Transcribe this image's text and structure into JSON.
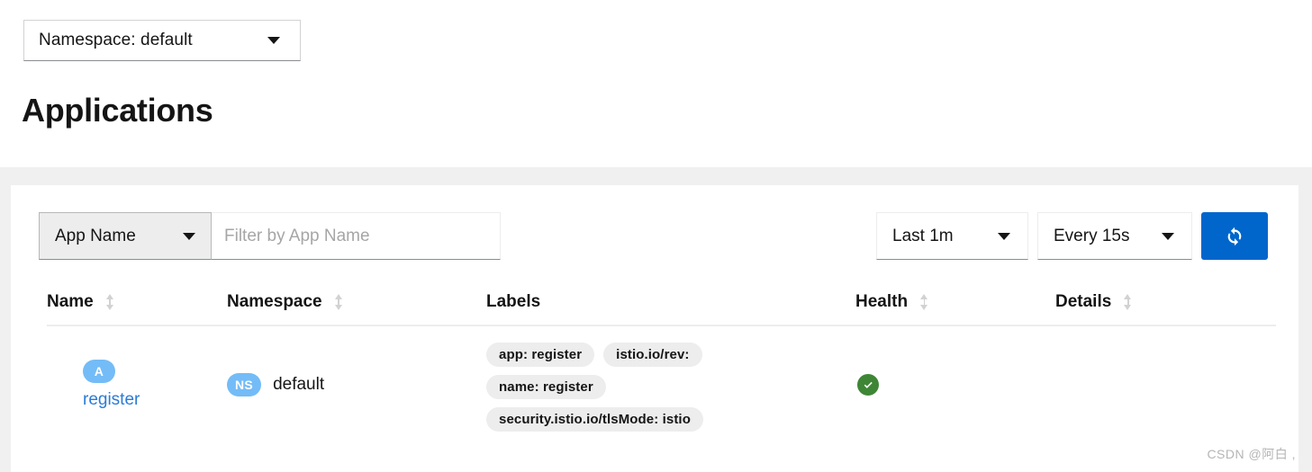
{
  "namespace_selector": {
    "label": "Namespace: default",
    "icon": "chevron-down-icon"
  },
  "page": {
    "title": "Applications"
  },
  "toolbar": {
    "filter_type": {
      "label": "App Name",
      "icon": "chevron-down-icon"
    },
    "filter_input": {
      "value": "",
      "placeholder": "Filter by App Name"
    },
    "duration": {
      "label": "Last 1m",
      "icon": "chevron-down-icon"
    },
    "refresh_interval": {
      "label": "Every 15s",
      "icon": "chevron-down-icon"
    },
    "refresh_button": {
      "icon": "sync-refresh-icon",
      "color": "#0066cc"
    }
  },
  "table": {
    "columns": [
      {
        "label": "Name",
        "sort_icon": "sort-updown-icon"
      },
      {
        "label": "Namespace",
        "sort_icon": "sort-updown-icon"
      },
      {
        "label": "Labels",
        "sort_icon": ""
      },
      {
        "label": "Health",
        "sort_icon": "sort-updown-icon"
      },
      {
        "label": "Details",
        "sort_icon": "sort-updown-icon"
      }
    ],
    "rows": [
      {
        "name": {
          "badge": "A",
          "badge_color": "#73bcf7",
          "link": "register",
          "link_color": "#2b7bd6"
        },
        "namespace": {
          "badge": "NS",
          "badge_color": "#73bcf7",
          "text": "default"
        },
        "labels": [
          [
            "app: register",
            "istio.io/rev:"
          ],
          [
            "name: register"
          ],
          [
            "security.istio.io/tlsMode: istio"
          ]
        ],
        "health": {
          "status": "healthy",
          "icon": "check-circle-icon",
          "color": "#3e8635"
        },
        "details": ""
      }
    ]
  },
  "watermark": {
    "text": "CSDN @阿白 ,"
  }
}
